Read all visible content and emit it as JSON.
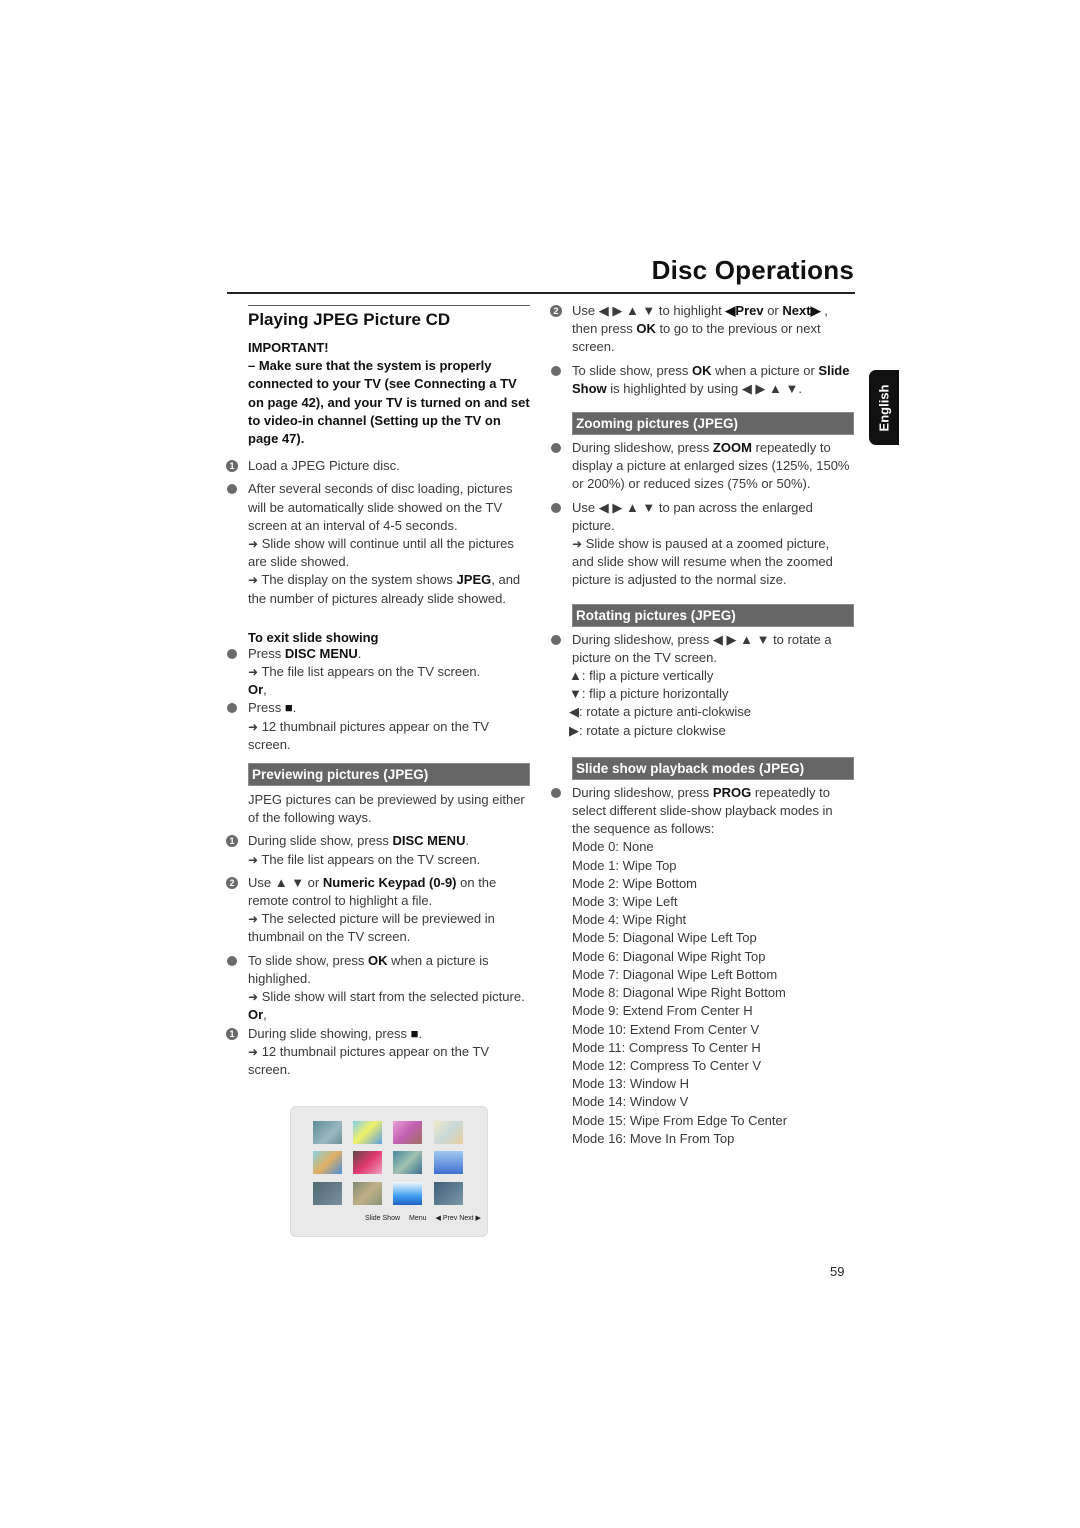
{
  "header": {
    "title": "Disc Operations"
  },
  "language_tab": "English",
  "page_number": "59",
  "left": {
    "section_title": "Playing JPEG Picture CD",
    "important_label": "IMPORTANT!",
    "important_text": "–  Make sure that the system is properly connected to your TV (see Connecting a TV on page 42), and your TV is turned on and set to video-in channel (Setting up the TV on page 47).",
    "step1": "Load a JPEG Picture disc.",
    "auto_para": "After several seconds of disc loading, pictures will be automatically slide showed on the TV screen at an interval of 4-5 seconds.",
    "auto_note1": "Slide show will continue until all the pictures are slide showed.",
    "auto_note2_pre": "The display on the system shows ",
    "auto_note2_bold": "JPEG",
    "auto_note2_post": ", and the number of pictures already slide showed.",
    "exit_title": "To exit slide showing",
    "exit_press": "Press ",
    "exit_disc_menu": "DISC MENU",
    "exit_note1": "The file list appears on the TV screen.",
    "or_label": "Or",
    "exit_press2": "Press ",
    "stop_symbol": "■",
    "exit_note2": "12 thumbnail pictures appear on the TV screen.",
    "preview_bar": "Previewing pictures (JPEG)",
    "preview_intro": "JPEG pictures can be previewed by using either of the following ways.",
    "pv1_pre": "During slide show, press ",
    "pv1_bold": "DISC MENU",
    "pv1_note": "The file list appears on the TV screen.",
    "pv2_pre": "Use ▲ ▼  or ",
    "pv2_bold": "Numeric Keypad (0-9)",
    "pv2_post": " on the remote control to highlight a file.",
    "pv2_note": "The selected picture will be previewed in thumbnail on the TV screen.",
    "pv3_pre": "To slide show, press ",
    "pv3_bold": "OK",
    "pv3_post": " when a picture is highlighed.",
    "pv3_note": "Slide show will start from the selected picture.",
    "pv4_pre": "During slide showing, press ",
    "pv4_note": "12 thumbnail pictures appear on the TV screen.",
    "thumb_labels": {
      "slide_show": "Slide Show",
      "menu": "Menu",
      "prev_next": "◀ Prev Next ▶"
    }
  },
  "right": {
    "r1_pre": "Use ◀ ▶ ▲ ▼  to highlight ",
    "r1_prev": "◀Prev",
    "r1_or": " or ",
    "r1_next": "Next▶",
    "r1_mid": " , then press ",
    "r1_ok": "OK",
    "r1_post": " to go to the previous or next screen.",
    "r2_pre": "To slide show, press ",
    "r2_ok": "OK",
    "r2_mid": " when a picture or ",
    "r2_bold": "Slide Show",
    "r2_post": " is highlighted by using ◀ ▶ ▲ ▼.",
    "zoom_bar": "Zooming pictures (JPEG)",
    "z1_pre": "During slideshow, press ",
    "z1_bold": "ZOOM",
    "z1_post": " repeatedly to display a picture at enlarged sizes (125%, 150% or 200%) or reduced sizes (75% or 50%).",
    "z2": "Use ◀ ▶ ▲ ▼  to pan across the enlarged picture.",
    "z2_note": "Slide show is paused at a zoomed picture, and slide show will resume when the zoomed picture is adjusted to the normal size.",
    "rotate_bar": "Rotating pictures (JPEG)",
    "rot_intro": "During slideshow, press ◀ ▶ ▲ ▼  to rotate a picture on the TV screen.",
    "rot_lines": [
      "▲: flip a picture vertically",
      "▼: flip a picture  horizontally",
      "◀: rotate a picture anti-clokwise",
      "▶: rotate a picture clokwise"
    ],
    "modes_bar": "Slide show playback modes (JPEG)",
    "modes_pre": "During slideshow, press ",
    "modes_bold": "PROG",
    "modes_post": " repeatedly to select different slide-show playback modes in the sequence as follows:",
    "modes": [
      "Mode 0: None",
      "Mode 1: Wipe Top",
      "Mode 2: Wipe Bottom",
      "Mode 3: Wipe Left",
      "Mode 4: Wipe Right",
      "Mode 5: Diagonal Wipe Left Top",
      "Mode 6: Diagonal Wipe Right Top",
      "Mode 7: Diagonal Wipe Left Bottom",
      "Mode 8: Diagonal Wipe Right Bottom",
      "Mode 9: Extend From Center H",
      "Mode 10: Extend From Center V",
      "Mode 11: Compress To Center H",
      "Mode 12: Compress To Center V",
      "Mode 13: Window H",
      "Mode 14: Window V",
      "Mode 15: Wipe From Edge To Center",
      "Mode 16: Move In From Top"
    ]
  },
  "icons": {
    "arrow": "➜",
    "step1": "1",
    "step2": "2"
  }
}
